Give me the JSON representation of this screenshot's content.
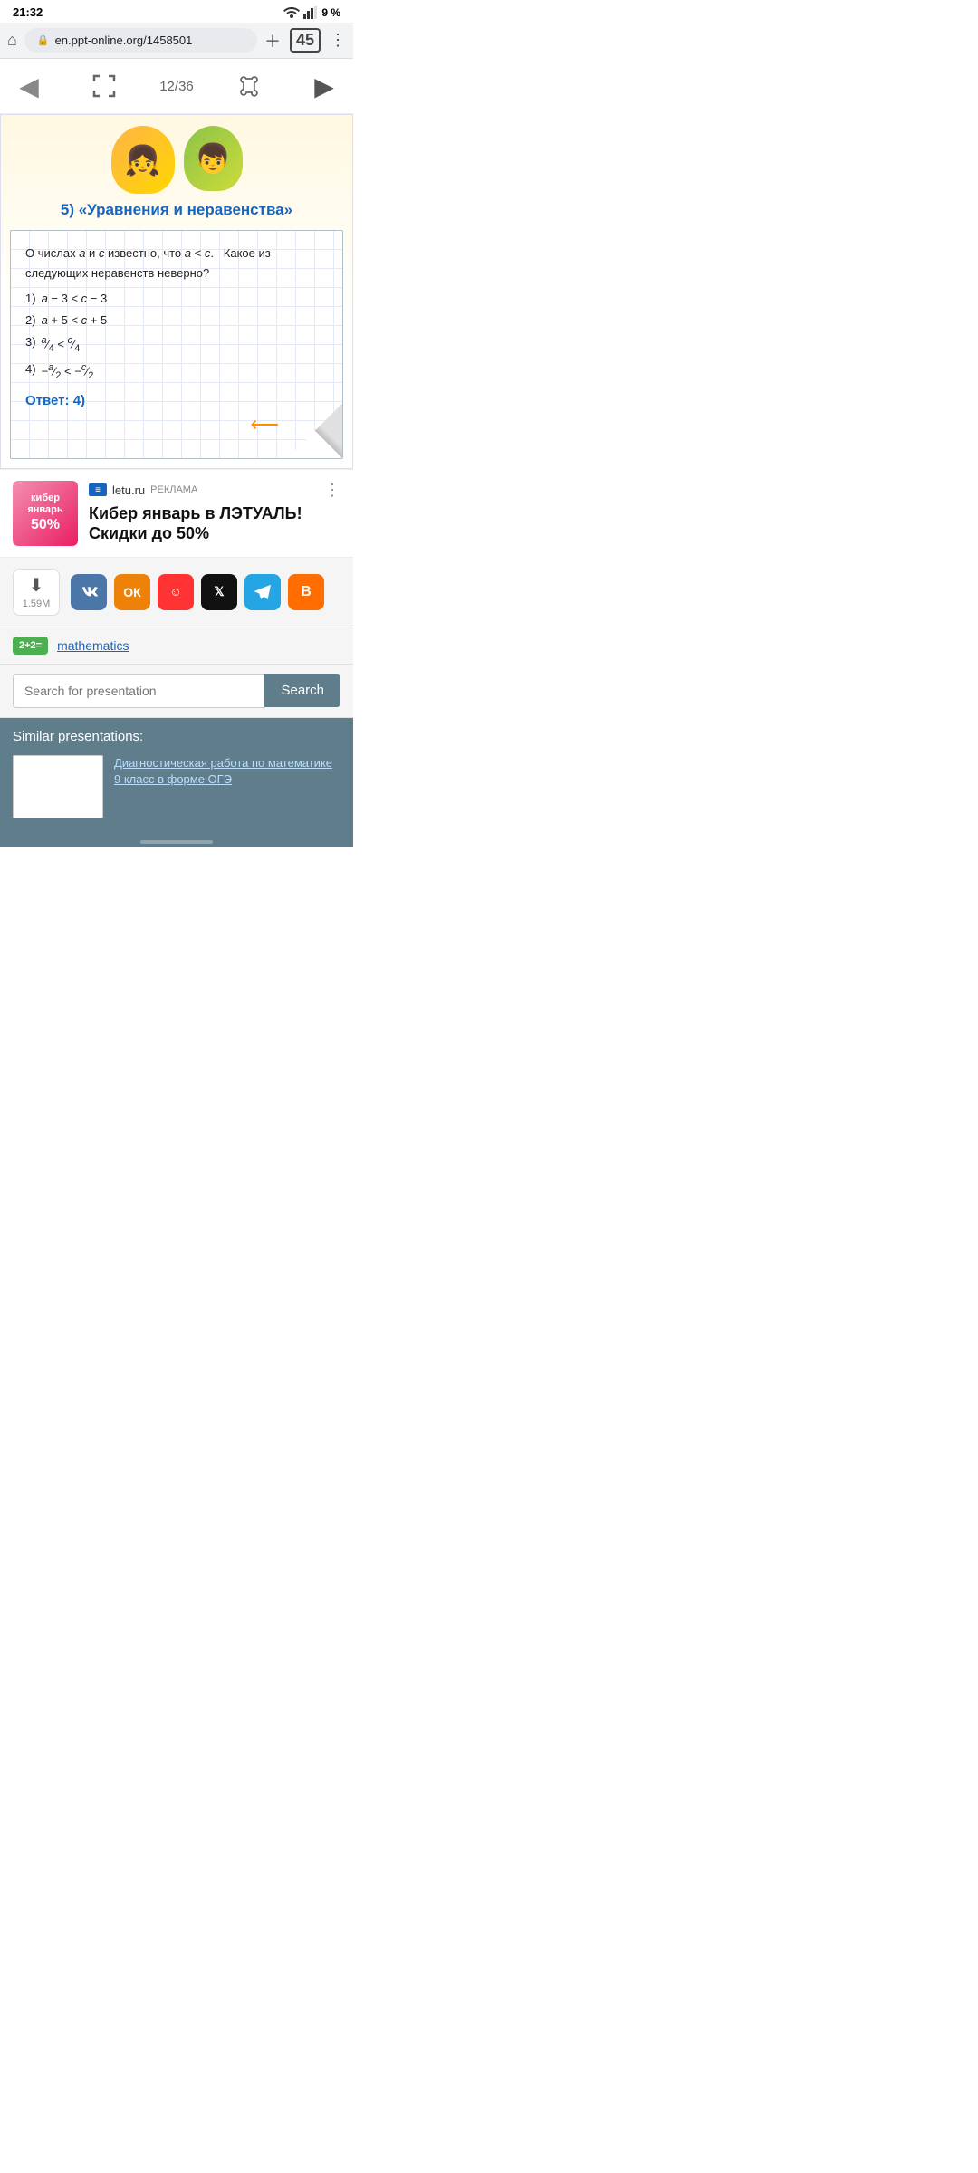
{
  "statusBar": {
    "time": "21:32",
    "battery": "9 %"
  },
  "browserBar": {
    "url": "en.ppt-online.org/1458501",
    "tabCount": "45"
  },
  "slideNav": {
    "current": "12",
    "total": "36",
    "counter": "12/36"
  },
  "slideContent": {
    "title": "5)  «Уравнения и неравенства»",
    "intro": "О числах a и с известно, что a < с.   Какое из следующих неравенств неверно?",
    "options": [
      "1)  a − 3 < c − 3",
      "2)  a + 5 < c + 5",
      "3)  a/4 < c/4",
      "4)  −a/2 < −c/2"
    ],
    "answer": "Ответ: 4)"
  },
  "ad": {
    "source": "letu.ru",
    "label": "РЕКЛАМА",
    "title": "Кибер январь в ЛЭТУАЛЬ! Скидки до 50%",
    "thumbText": "кибер\nянварь\n50%"
  },
  "downloadRow": {
    "size": "1.59M",
    "downloadLabel": "⬇",
    "socials": [
      {
        "name": "vk",
        "label": "ВК"
      },
      {
        "name": "ok",
        "label": "ОК"
      },
      {
        "name": "mm",
        "label": "МЧ"
      },
      {
        "name": "x",
        "label": "X"
      },
      {
        "name": "tg",
        "label": "TG"
      },
      {
        "name": "bl",
        "label": "BL"
      }
    ]
  },
  "category": {
    "icon": "2+2=",
    "label": "mathematics"
  },
  "search": {
    "placeholder": "Search for presentation",
    "buttonLabel": "Search"
  },
  "similar": {
    "sectionTitle": "Similar presentations:",
    "items": [
      {
        "title": "Диагностическая работа по математике 9 класс в форме ОГЭ"
      }
    ]
  }
}
